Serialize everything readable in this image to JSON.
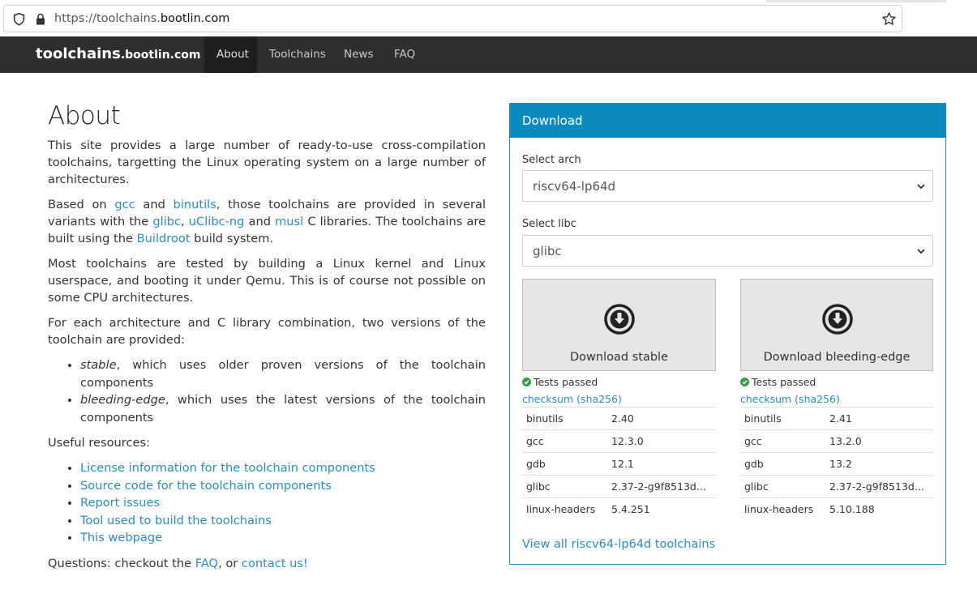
{
  "browser": {
    "url_prefix": "https://toolchains.",
    "url_domain": "bootlin.com"
  },
  "nav": {
    "brand_main": "toolchains",
    "brand_suffix": ".bootlin.com",
    "items": [
      {
        "label": "About"
      },
      {
        "label": "Toolchains"
      },
      {
        "label": "News"
      },
      {
        "label": "FAQ"
      }
    ]
  },
  "about": {
    "title": "About",
    "p1": "This site provides a large number of ready-to-use cross-compilation toolchains, targetting the Linux operating system on a large number of architectures.",
    "p2": {
      "t1": "Based on ",
      "gcc": "gcc",
      "t2": " and ",
      "binutils": "binutils",
      "t3": ", those toolchains are provided in several variants with the ",
      "glibc": "glibc",
      "t4": ", ",
      "uclibc": "uClibc-ng",
      "t5": " and ",
      "musl": "musl",
      "t6": " C libraries. The toolchains are built using the ",
      "buildroot": "Buildroot",
      "t7": " build system."
    },
    "p3": "Most toolchains are tested by building a Linux kernel and Linux userspace, and booting it under Qemu. This is of course not possible on some CPU architectures.",
    "p4": "For each architecture and C library combination, two versions of the toolchain are provided:",
    "versions": [
      {
        "em": "stable",
        "rest": ", which uses older proven versions of the toolchain components"
      },
      {
        "em": "bleeding-edge",
        "rest": ", which uses the latest versions of the toolchain components"
      }
    ],
    "resources_title": "Useful resources:",
    "resources": [
      "License information for the toolchain components",
      "Source code for the toolchain components",
      "Report issues",
      "Tool used to build the toolchains",
      "This webpage"
    ],
    "questions": {
      "t1": "Questions: checkout the ",
      "faq": "FAQ",
      "t2": ", or ",
      "contact": "contact us!"
    }
  },
  "download": {
    "title": "Download",
    "arch_label": "Select arch",
    "arch_value": "riscv64-lp64d",
    "libc_label": "Select libc",
    "libc_value": "glibc",
    "stable": {
      "button": "Download stable",
      "tests": "Tests passed",
      "checksum": "checksum (sha256)",
      "components": [
        {
          "name": "binutils",
          "version": "2.40"
        },
        {
          "name": "gcc",
          "version": "12.3.0"
        },
        {
          "name": "gdb",
          "version": "12.1"
        },
        {
          "name": "glibc",
          "version": "2.37-2-g9f8513d..."
        },
        {
          "name": "linux-headers",
          "version": "5.4.251"
        }
      ]
    },
    "bleeding": {
      "button": "Download bleeding-edge",
      "tests": "Tests passed",
      "checksum": "checksum (sha256)",
      "components": [
        {
          "name": "binutils",
          "version": "2.41"
        },
        {
          "name": "gcc",
          "version": "13.2.0"
        },
        {
          "name": "gdb",
          "version": "13.2"
        },
        {
          "name": "glibc",
          "version": "2.37-2-g9f8513d..."
        },
        {
          "name": "linux-headers",
          "version": "5.10.188"
        }
      ]
    },
    "view_all": "View all riscv64-lp64d toolchains"
  },
  "colors": {
    "navbar": "#2e2e2e",
    "panel_header": "#0b8bbd",
    "link": "#2a8cc0",
    "success": "#3a9a4a"
  }
}
